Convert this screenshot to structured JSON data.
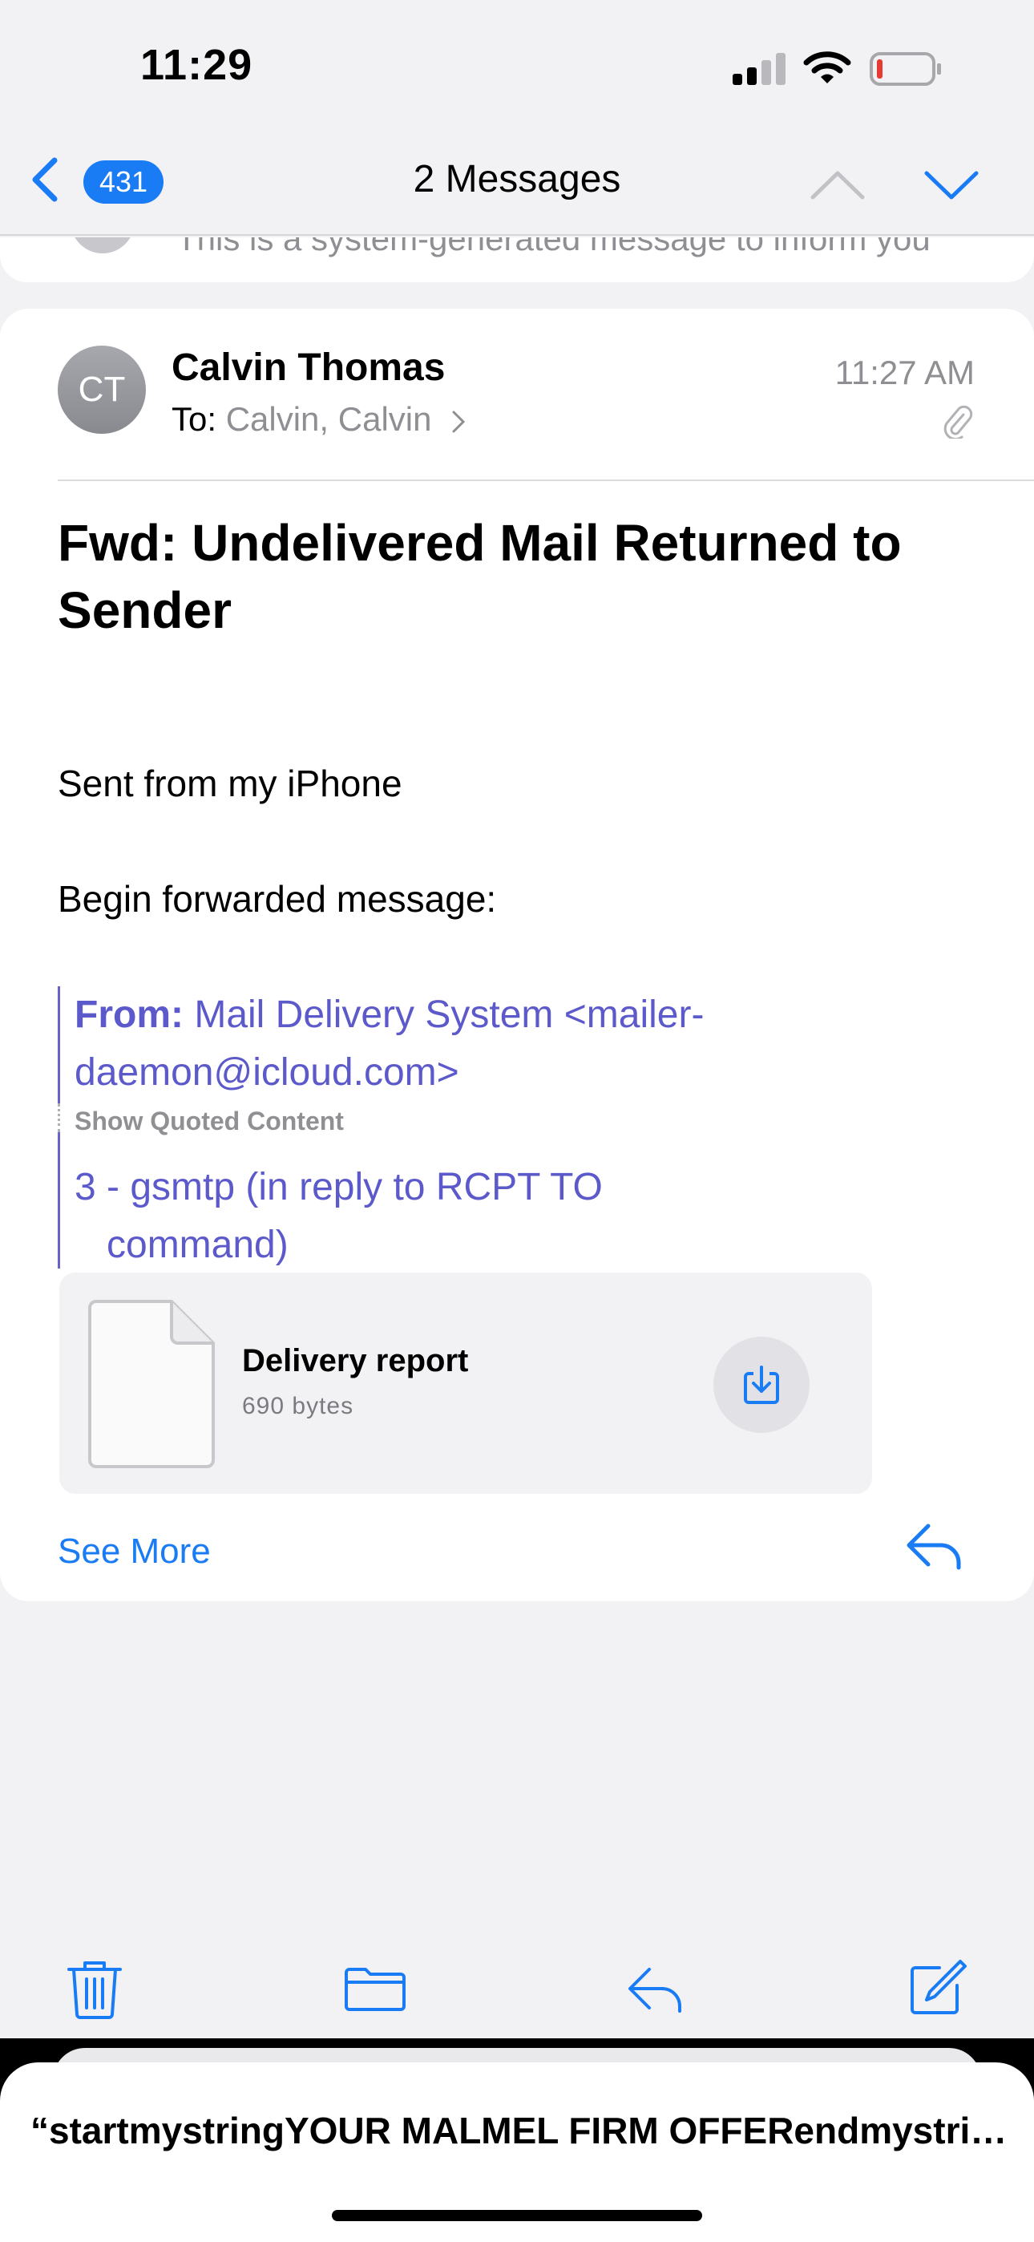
{
  "status_bar": {
    "time": "11:29"
  },
  "nav": {
    "back_count": "431",
    "title": "2 Messages"
  },
  "previous_message": {
    "preview": "This is a system-generated message to inform you"
  },
  "message": {
    "avatar_initials": "CT",
    "sender": "Calvin Thomas",
    "to_label": "To:",
    "recipients": "Calvin, Calvin",
    "time": "11:27 AM",
    "subject": "Fwd: Undelivered Mail Returned to Sender",
    "body": {
      "signature": "Sent from my iPhone",
      "forward_intro": "Begin forwarded message:"
    },
    "quote": {
      "from_label": "From:",
      "from_value": "Mail Delivery System <mailer-daemon@icloud.com>",
      "show_quoted": "Show Quoted Content",
      "tail_line1": "3 - gsmtp (in reply to RCPT TO",
      "tail_line2": "command)"
    },
    "attachment": {
      "name": "Delivery report",
      "size": "690 bytes"
    },
    "see_more": "See More"
  },
  "notification": {
    "text": "“startmystringYOUR MALMEL FIRM OFFERendmystring”"
  },
  "colors": {
    "accent": "#1a7cf5",
    "quote": "#5c5acb",
    "secondary_text": "#8e8e93"
  },
  "icons": {
    "back": "chevron-left-icon",
    "previous": "chevron-up-icon",
    "next": "chevron-down-icon",
    "attachment": "paperclip-icon",
    "download": "download-icon",
    "reply": "reply-icon",
    "trash": "trash-icon",
    "folder": "folder-icon",
    "compose": "compose-icon"
  }
}
